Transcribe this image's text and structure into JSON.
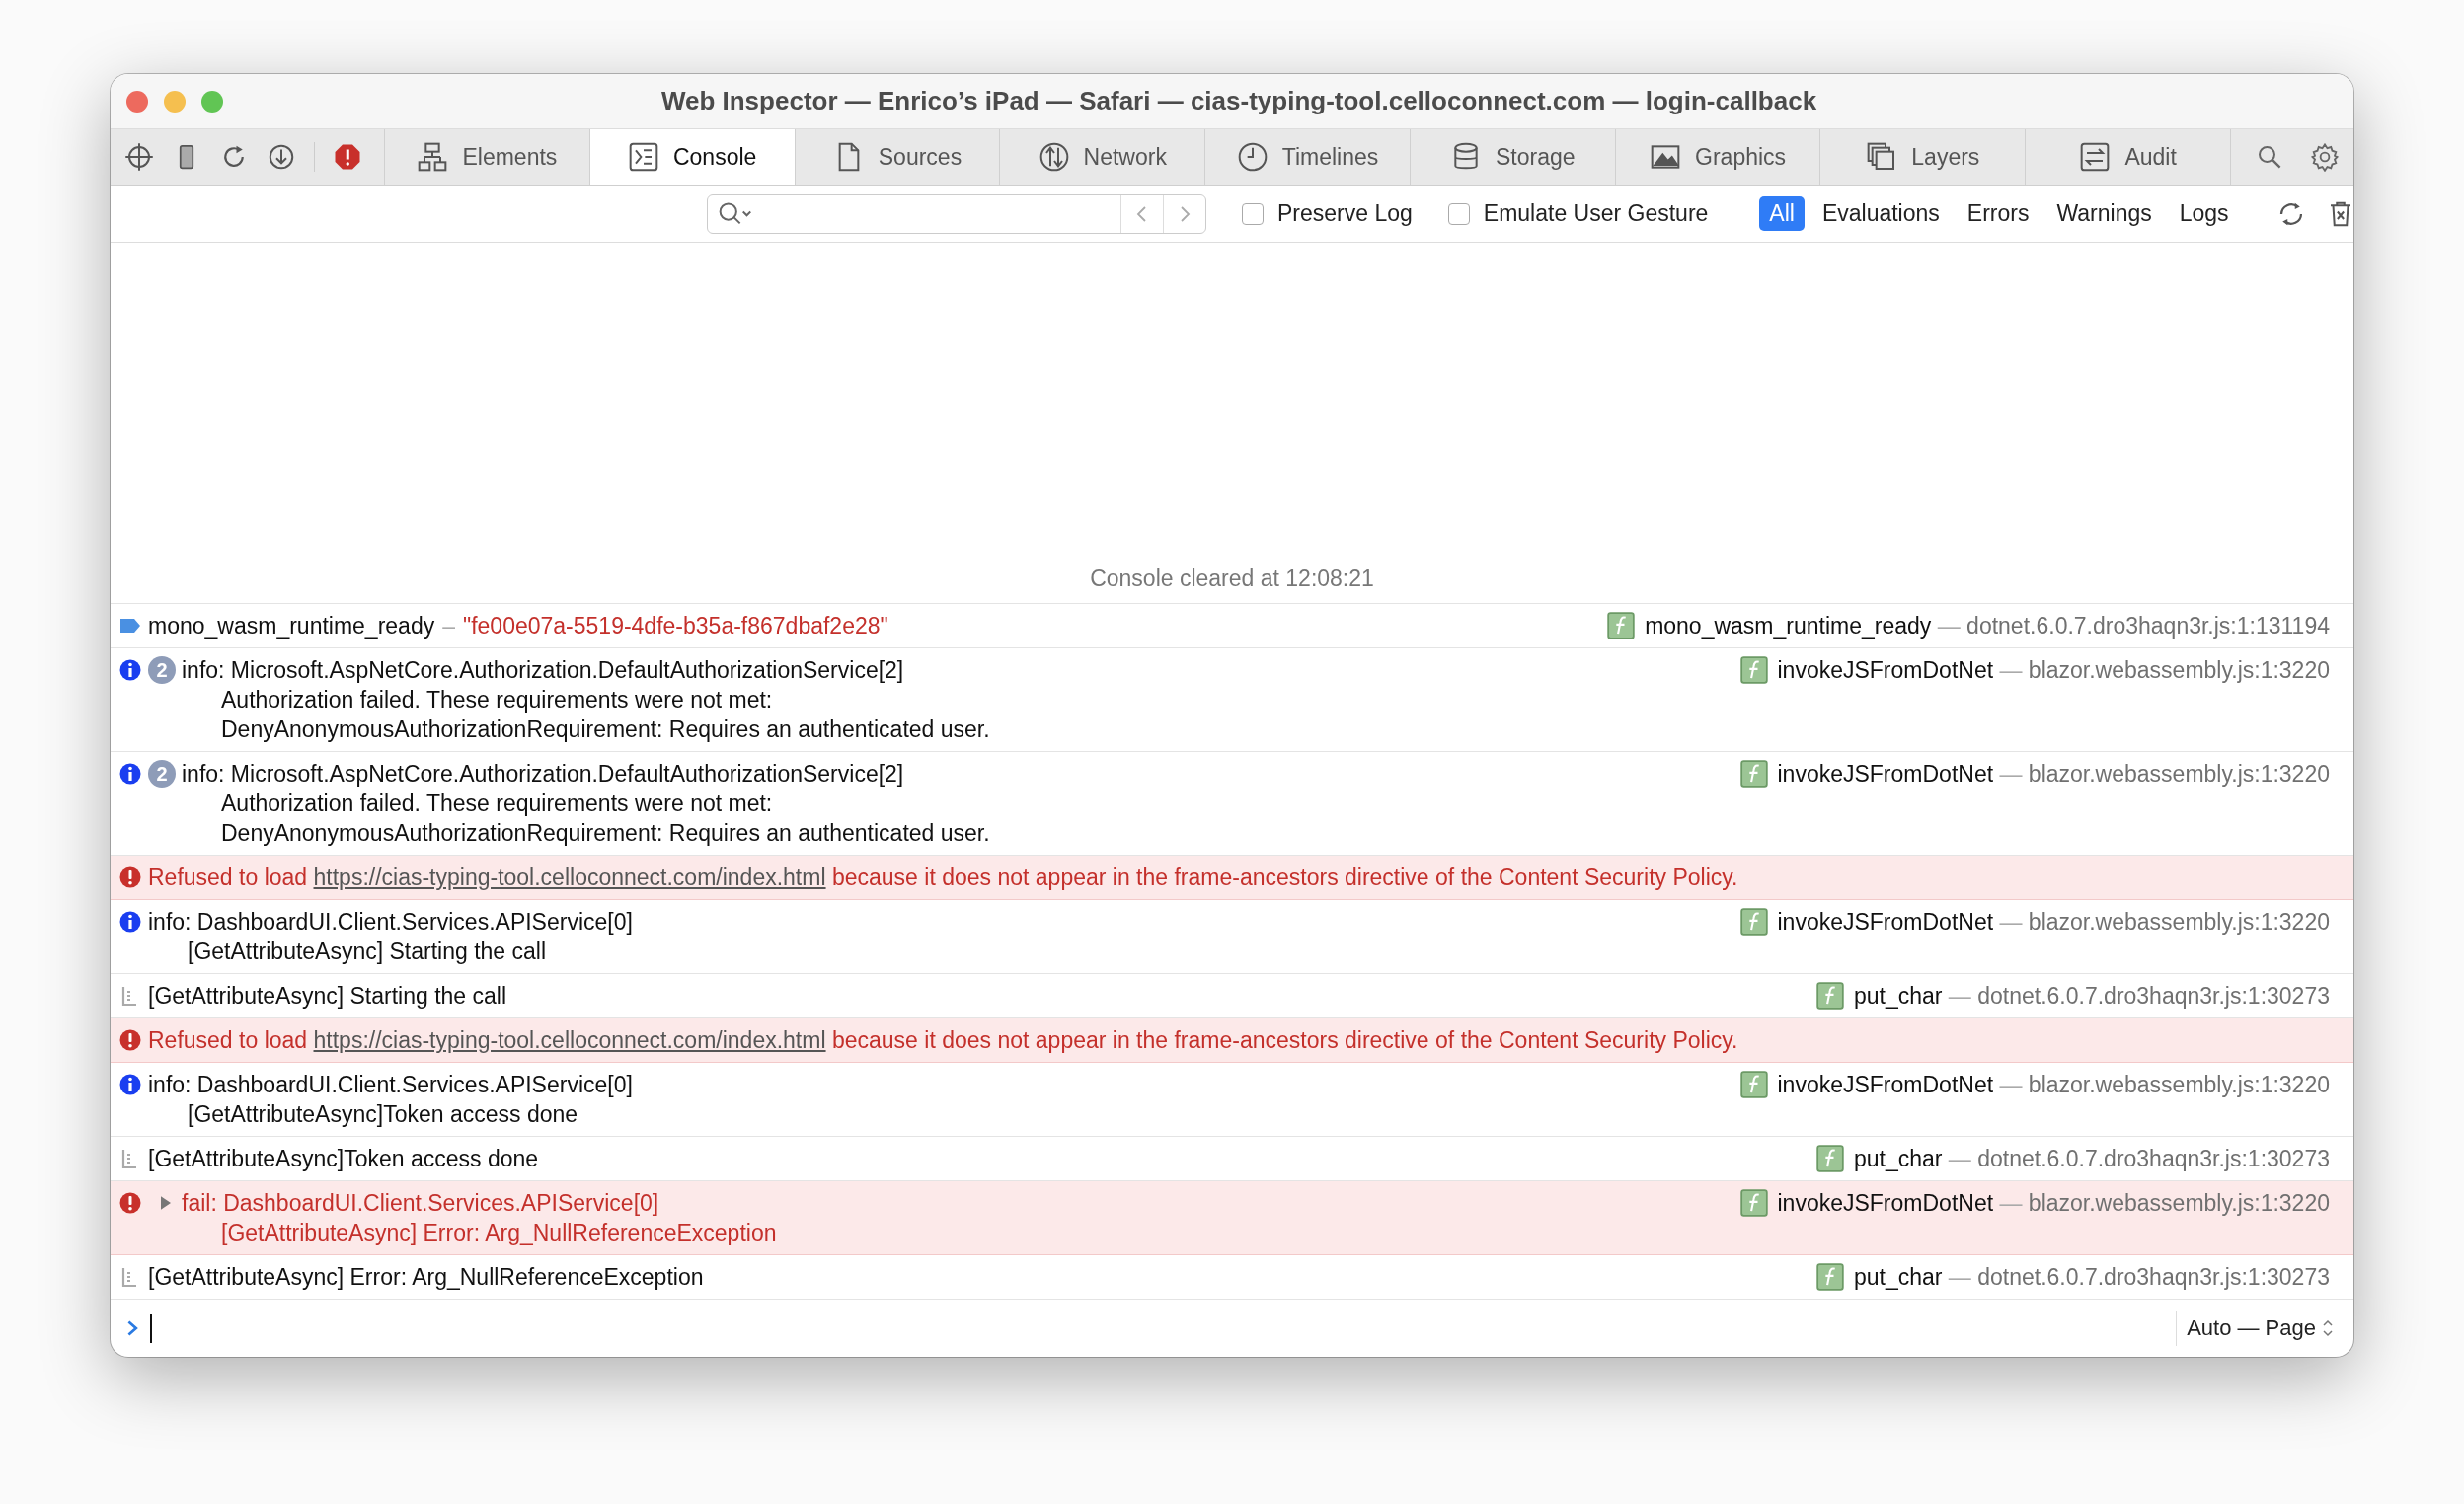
{
  "window": {
    "title": "Web Inspector — Enrico’s iPad — Safari — cias-typing-tool.celloconnect.com — login-callback"
  },
  "tabs": [
    {
      "label": "Elements",
      "selected": false
    },
    {
      "label": "Console",
      "selected": true
    },
    {
      "label": "Sources",
      "selected": false
    },
    {
      "label": "Network",
      "selected": false
    },
    {
      "label": "Timelines",
      "selected": false
    },
    {
      "label": "Storage",
      "selected": false
    },
    {
      "label": "Graphics",
      "selected": false
    },
    {
      "label": "Layers",
      "selected": false
    },
    {
      "label": "Audit",
      "selected": false
    }
  ],
  "filter_bar": {
    "checkboxes": [
      {
        "label": "Preserve Log",
        "checked": false
      },
      {
        "label": "Emulate User Gesture",
        "checked": false
      }
    ],
    "levels": [
      {
        "label": "All",
        "selected": true
      },
      {
        "label": "Evaluations",
        "selected": false
      },
      {
        "label": "Errors",
        "selected": false
      },
      {
        "label": "Warnings",
        "selected": false
      },
      {
        "label": "Logs",
        "selected": false
      }
    ]
  },
  "console": {
    "cleared_message": "Console cleared at 12:08:21",
    "messages": [
      {
        "kind": "log",
        "lines": [
          "mono_wasm_runtime_ready"
        ],
        "separator": "–",
        "value": "\"fe00e07a-5519-4dfe-b35a-f867dbaf2e28\"",
        "source": {
          "function": "mono_wasm_runtime_ready",
          "separator": "—",
          "location": "dotnet.6.0.7.dro3haqn3r.js:1:131194"
        }
      },
      {
        "kind": "info",
        "count": "2",
        "lines": [
          "info: Microsoft.AspNetCore.Authorization.DefaultAuthorizationService[2]",
          "Authorization failed. These requirements were not met:",
          "DenyAnonymousAuthorizationRequirement: Requires an authenticated user."
        ],
        "source": {
          "function": "invokeJSFromDotNet",
          "separator": "—",
          "location": "blazor.webassembly.js:1:3220"
        }
      },
      {
        "kind": "info",
        "count": "2",
        "lines": [
          "info: Microsoft.AspNetCore.Authorization.DefaultAuthorizationService[2]",
          "Authorization failed. These requirements were not met:",
          "DenyAnonymousAuthorizationRequirement: Requires an authenticated user."
        ],
        "source": {
          "function": "invokeJSFromDotNet",
          "separator": "—",
          "location": "blazor.webassembly.js:1:3220"
        }
      },
      {
        "kind": "error",
        "text": "Refused to load",
        "link": "https://cias-typing-tool.celloconnect.com/index.html",
        "text_after": "because it does not appear in the frame-ancestors directive of the Content Security Policy."
      },
      {
        "kind": "info",
        "lines": [
          "info: DashboardUI.Client.Services.APIService[0]",
          "[GetAttributeAsync] Starting the call"
        ],
        "source": {
          "function": "invokeJSFromDotNet",
          "separator": "—",
          "location": "blazor.webassembly.js:1:3220"
        }
      },
      {
        "kind": "output",
        "lines": [
          "[GetAttributeAsync] Starting the call"
        ],
        "source": {
          "function": "put_char",
          "separator": "—",
          "location": "dotnet.6.0.7.dro3haqn3r.js:1:30273"
        }
      },
      {
        "kind": "error",
        "text": "Refused to load",
        "link": "https://cias-typing-tool.celloconnect.com/index.html",
        "text_after": "because it does not appear in the frame-ancestors directive of the Content Security Policy."
      },
      {
        "kind": "info",
        "lines": [
          "info: DashboardUI.Client.Services.APIService[0]",
          "[GetAttributeAsync]Token access done"
        ],
        "source": {
          "function": "invokeJSFromDotNet",
          "separator": "—",
          "location": "blazor.webassembly.js:1:3220"
        }
      },
      {
        "kind": "output",
        "lines": [
          "[GetAttributeAsync]Token access done"
        ],
        "source": {
          "function": "put_char",
          "separator": "—",
          "location": "dotnet.6.0.7.dro3haqn3r.js:1:30273"
        }
      },
      {
        "kind": "error",
        "expanded": false,
        "lines": [
          "fail: DashboardUI.Client.Services.APIService[0]",
          "[GetAttributeAsync] Error: Arg_NullReferenceException"
        ],
        "source": {
          "function": "invokeJSFromDotNet",
          "separator": "—",
          "location": "blazor.webassembly.js:1:3220"
        }
      },
      {
        "kind": "output",
        "lines": [
          "[GetAttributeAsync] Error: Arg_NullReferenceException"
        ],
        "source": {
          "function": "put_char",
          "separator": "—",
          "location": "dotnet.6.0.7.dro3haqn3r.js:1:30273"
        }
      }
    ],
    "prompt": {
      "context": "Auto — Page"
    }
  }
}
